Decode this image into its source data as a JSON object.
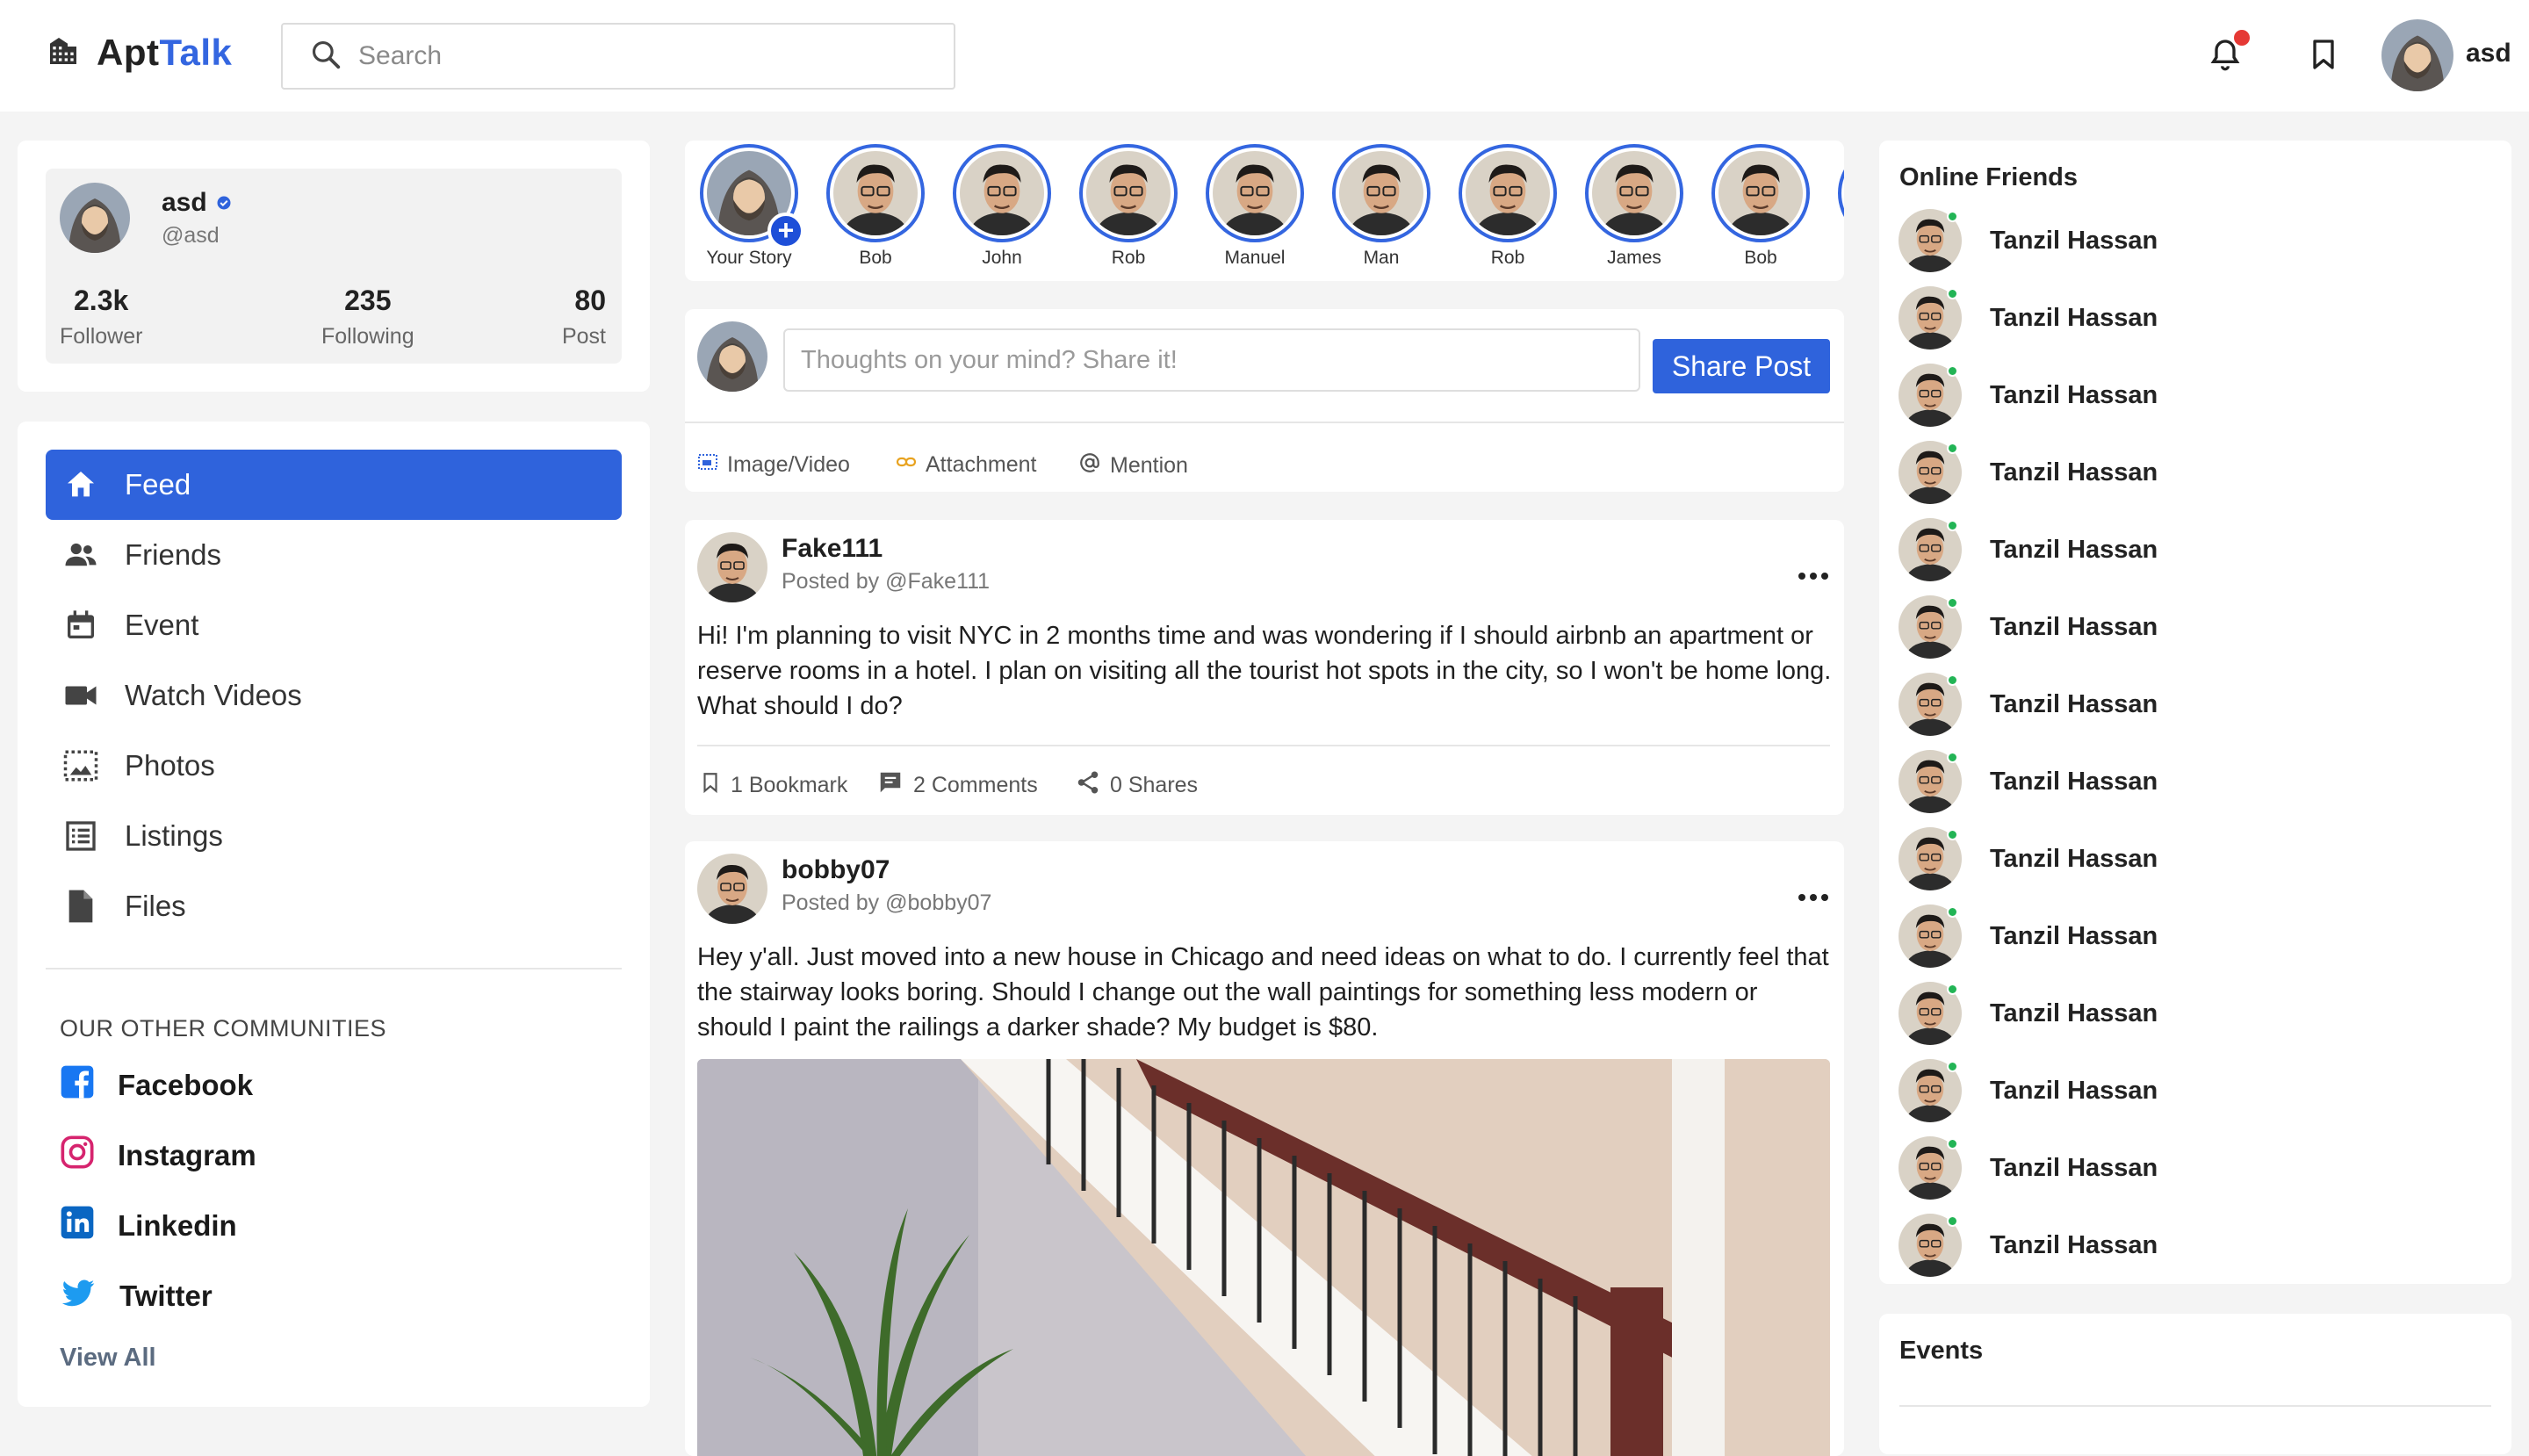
{
  "app": {
    "brand_part1": "Apt",
    "brand_part2": "Talk",
    "brand_icon": "building-icon"
  },
  "header": {
    "search_placeholder": "Search",
    "username": "asd",
    "notification_icon": "bell-icon",
    "bookmark_icon": "bookmark-icon"
  },
  "profile": {
    "name": "asd",
    "handle": "@asd",
    "verified": true,
    "stats": [
      {
        "value": "2.3k",
        "label": "Follower"
      },
      {
        "value": "235",
        "label": "Following"
      },
      {
        "value": "80",
        "label": "Post"
      }
    ]
  },
  "nav": [
    {
      "label": "Feed",
      "icon": "home-icon",
      "active": true
    },
    {
      "label": "Friends",
      "icon": "people-icon"
    },
    {
      "label": "Event",
      "icon": "calendar-icon"
    },
    {
      "label": "Watch Videos",
      "icon": "videocam-icon"
    },
    {
      "label": "Photos",
      "icon": "photo-icon"
    },
    {
      "label": "Listings",
      "icon": "list-icon"
    },
    {
      "label": "Files",
      "icon": "file-icon"
    }
  ],
  "communities": {
    "title": "OUR OTHER COMMUNITIES",
    "items": [
      {
        "label": "Facebook",
        "icon": "facebook-icon"
      },
      {
        "label": "Instagram",
        "icon": "instagram-icon"
      },
      {
        "label": "Linkedin",
        "icon": "linkedin-icon"
      },
      {
        "label": "Twitter",
        "icon": "twitter-icon"
      }
    ],
    "view_all": "View All"
  },
  "stories": [
    "Your Story",
    "Bob",
    "John",
    "Rob",
    "Manuel",
    "Man",
    "Rob",
    "James",
    "Bob"
  ],
  "composer": {
    "placeholder": "Thoughts on your mind? Share it!",
    "button": "Share Post",
    "options": [
      {
        "label": "Image/Video",
        "icon": "image-icon"
      },
      {
        "label": "Attachment",
        "icon": "link-icon"
      },
      {
        "label": "Mention",
        "icon": "at-icon"
      }
    ]
  },
  "posts": [
    {
      "name": "Fake111",
      "by": "Posted by @Fake111",
      "text": "Hi! I'm planning to visit NYC in 2 months time and was wondering if I should airbnb an apartment or reserve rooms in a hotel. I plan on visiting all the tourist hot spots in the city, so I won't be home long. What should I do?",
      "bookmarks": "1 Bookmark",
      "comments": "2 Comments",
      "shares": "0 Shares"
    },
    {
      "name": "bobby07",
      "by": "Posted by @bobby07",
      "text": "Hey y'all. Just moved into a new house in Chicago and need ideas on what to do. I currently feel that the stairway looks boring. Should I change out the wall paintings for something less modern or should I paint the railings a darker shade? My budget is $80."
    }
  ],
  "online_friends": {
    "title": "Online Friends",
    "names": [
      "Tanzil Hassan",
      "Tanzil Hassan",
      "Tanzil Hassan",
      "Tanzil Hassan",
      "Tanzil Hassan",
      "Tanzil Hassan",
      "Tanzil Hassan",
      "Tanzil Hassan",
      "Tanzil Hassan",
      "Tanzil Hassan",
      "Tanzil Hassan",
      "Tanzil Hassan",
      "Tanzil Hassan",
      "Tanzil Hassan"
    ]
  },
  "events": {
    "title": "Events"
  },
  "colors": {
    "accent": "#2f63dc",
    "online": "#22b455",
    "notification": "#e53935"
  }
}
